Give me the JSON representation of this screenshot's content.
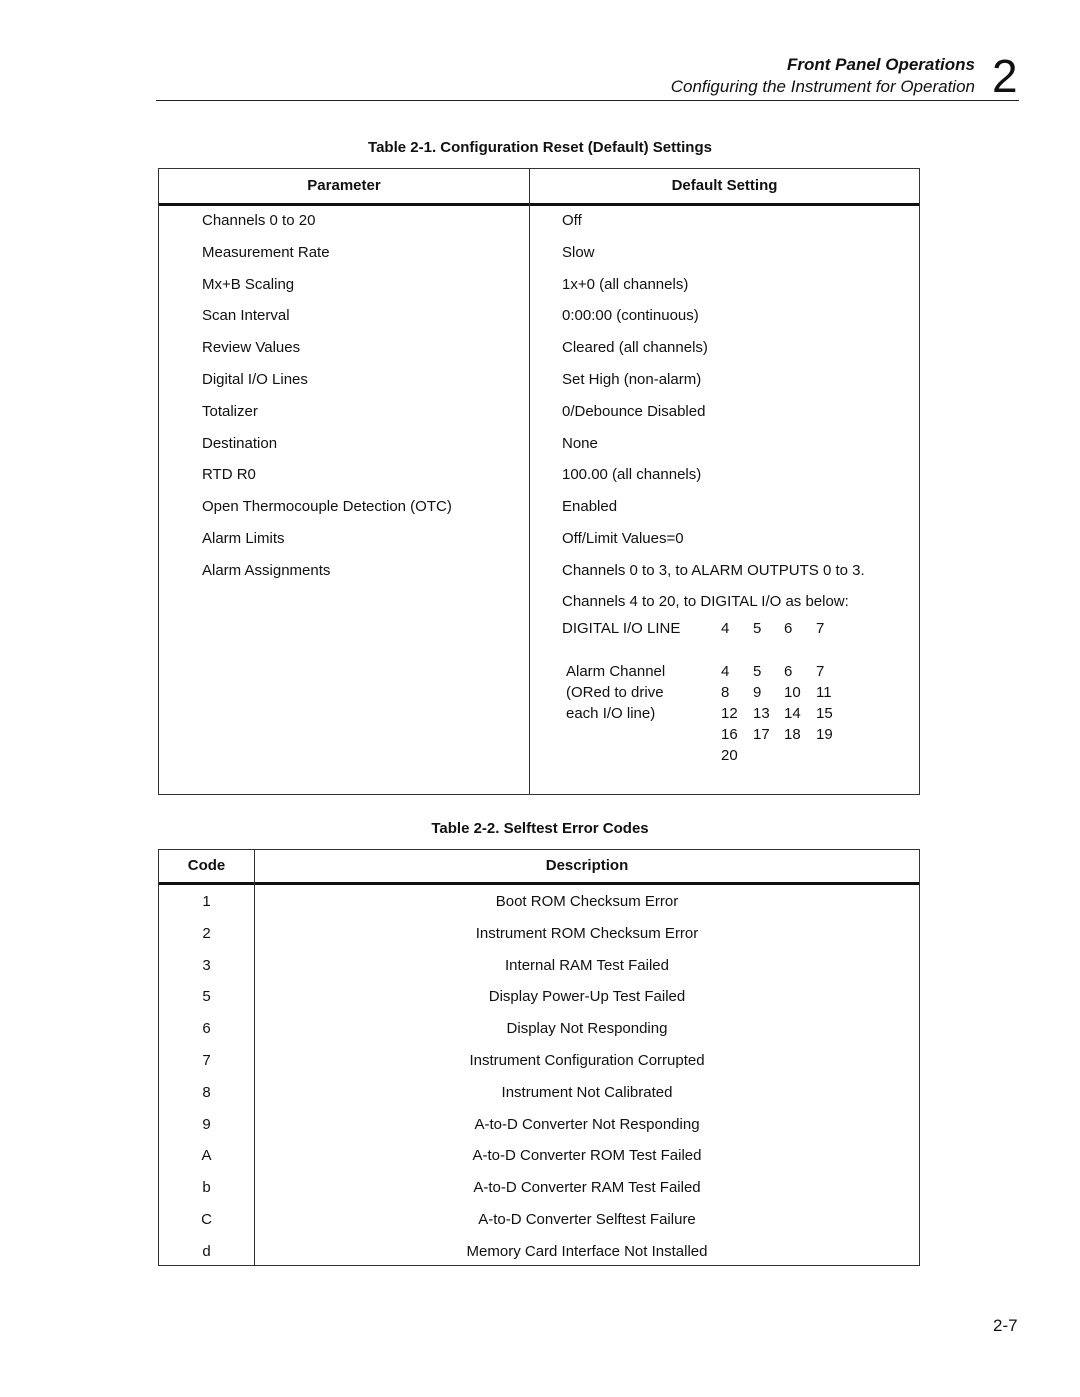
{
  "header": {
    "title": "Front Panel Operations",
    "subtitle": "Configuring the Instrument for Operation",
    "chapter": "2"
  },
  "table1": {
    "caption": "Table 2-1. Configuration Reset (Default) Settings",
    "columns": [
      "Parameter",
      "Default Setting"
    ],
    "rows": [
      {
        "parameter": "Channels 0 to 20",
        "setting": "Off"
      },
      {
        "parameter": "Measurement Rate",
        "setting": "Slow"
      },
      {
        "parameter": "Mx+B Scaling",
        "setting": "1x+0 (all channels)"
      },
      {
        "parameter": "Scan Interval",
        "setting": "0:00:00 (continuous)"
      },
      {
        "parameter": "Review Values",
        "setting": "Cleared (all channels)"
      },
      {
        "parameter": "Digital I/O Lines",
        "setting": "Set High (non-alarm)"
      },
      {
        "parameter": "Totalizer",
        "setting": "0/Debounce Disabled"
      },
      {
        "parameter": "Destination",
        "setting": "None"
      },
      {
        "parameter": "RTD R0",
        "setting": "100.00 (all channels)"
      },
      {
        "parameter": "Open Thermocouple Detection (OTC)",
        "setting": "Enabled"
      },
      {
        "parameter": "Alarm Limits",
        "setting": "Off/Limit Values=0"
      },
      {
        "parameter": "Alarm Assignments",
        "setting": "Channels 0 to 3, to ALARM OUTPUTS 0 to 3."
      }
    ],
    "alarm_extra": {
      "line1": "Channels 4 to 20, to DIGITAL I/O as below:",
      "io_line_label": "DIGITAL I/O LINE",
      "io_lines": [
        "4",
        "5",
        "6",
        "7"
      ],
      "alarm_label_lines": [
        "Alarm Channel",
        "(ORed to drive",
        "each I/O line)"
      ],
      "alarm_grid": [
        [
          "4",
          "5",
          "6",
          "7"
        ],
        [
          "8",
          "9",
          "10",
          "11"
        ],
        [
          "12",
          "13",
          "14",
          "15"
        ],
        [
          "16",
          "17",
          "18",
          "19"
        ],
        [
          "20",
          "",
          "",
          ""
        ]
      ]
    }
  },
  "table2": {
    "caption": "Table 2-2. Selftest Error Codes",
    "columns": [
      "Code",
      "Description"
    ],
    "rows": [
      {
        "code": "1",
        "description": "Boot ROM Checksum Error"
      },
      {
        "code": "2",
        "description": "Instrument ROM Checksum Error"
      },
      {
        "code": "3",
        "description": "Internal RAM Test Failed"
      },
      {
        "code": "5",
        "description": "Display Power-Up Test Failed"
      },
      {
        "code": "6",
        "description": "Display Not Responding"
      },
      {
        "code": "7",
        "description": "Instrument Configuration Corrupted"
      },
      {
        "code": "8",
        "description": "Instrument Not Calibrated"
      },
      {
        "code": "9",
        "description": "A-to-D Converter Not Responding"
      },
      {
        "code": "A",
        "description": "A-to-D Converter ROM Test Failed"
      },
      {
        "code": "b",
        "description": "A-to-D Converter RAM Test Failed"
      },
      {
        "code": "C",
        "description": "A-to-D Converter Selftest Failure"
      },
      {
        "code": "d",
        "description": "Memory Card Interface Not Installed"
      }
    ]
  },
  "footer": {
    "page_number": "2-7"
  }
}
